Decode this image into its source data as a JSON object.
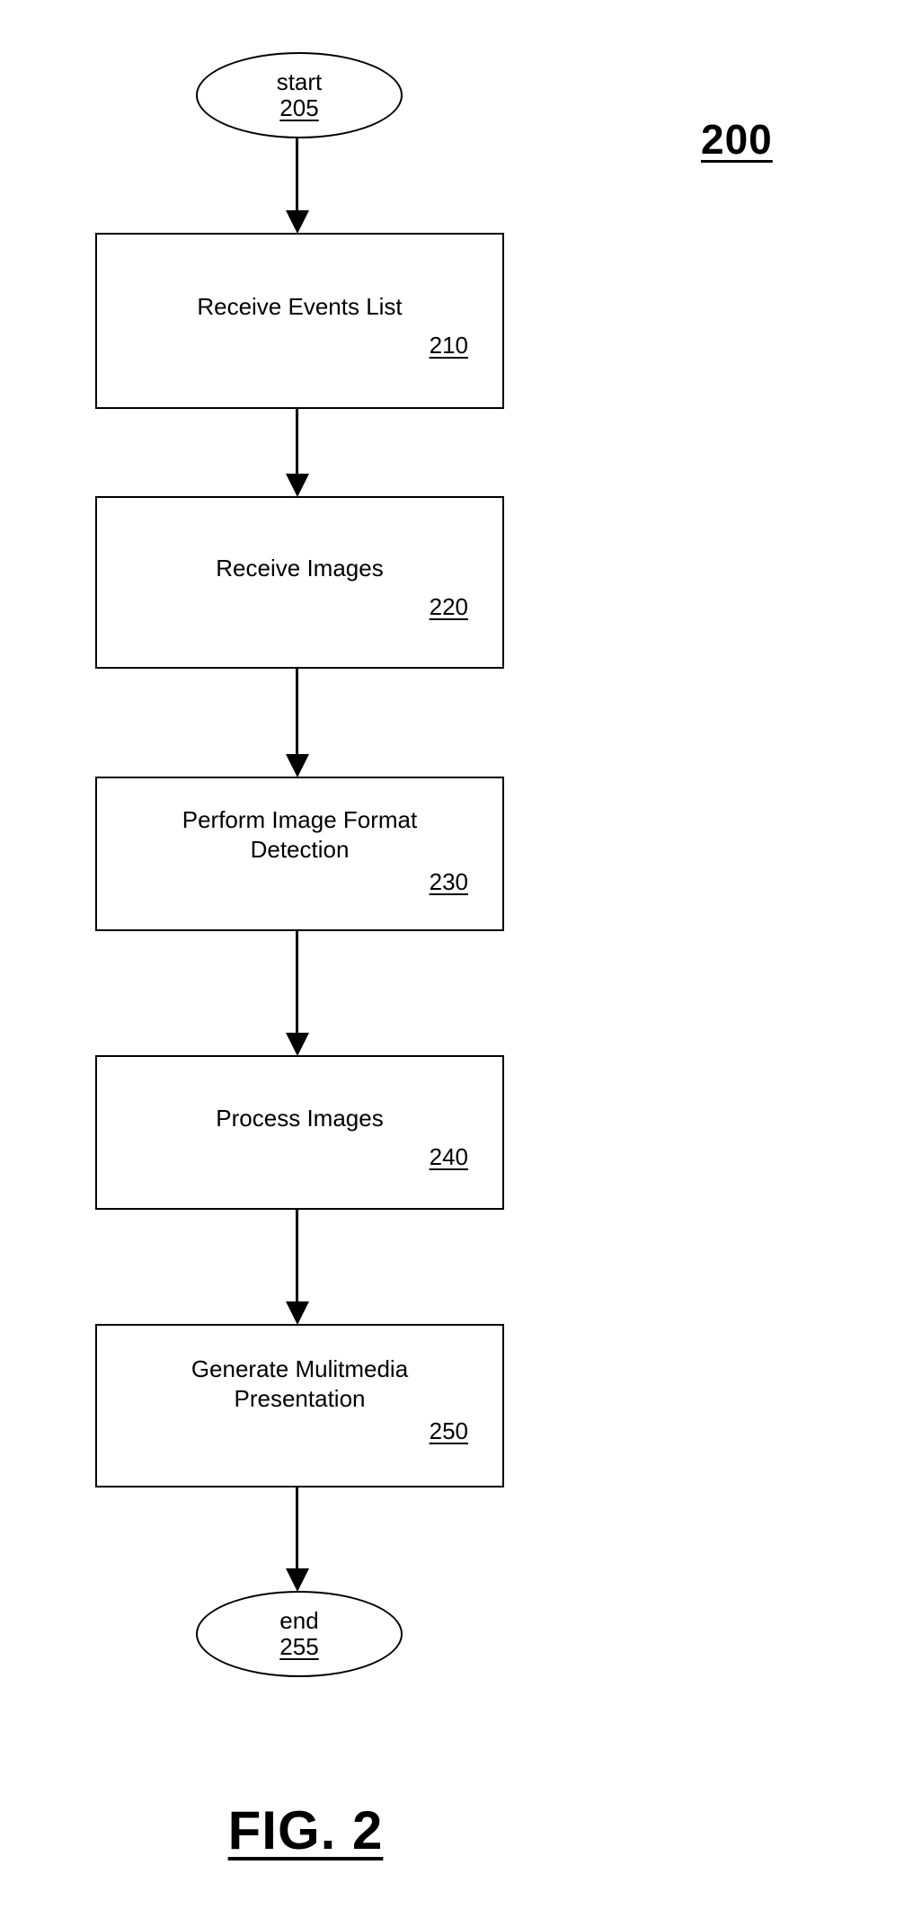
{
  "figure": {
    "reference_number": "200",
    "caption": "FIG. 2"
  },
  "flowchart": {
    "type": "flowchart",
    "orientation": "top-to-bottom",
    "nodes": [
      {
        "id": "205",
        "shape": "ellipse",
        "label": "start",
        "number": "205"
      },
      {
        "id": "210",
        "shape": "rectangle",
        "label": "Receive Events List",
        "number": "210"
      },
      {
        "id": "220",
        "shape": "rectangle",
        "label": "Receive Images",
        "number": "220"
      },
      {
        "id": "230",
        "shape": "rectangle",
        "label": "Perform Image Format\nDetection",
        "number": "230"
      },
      {
        "id": "240",
        "shape": "rectangle",
        "label": "Process Images",
        "number": "240"
      },
      {
        "id": "250",
        "shape": "rectangle",
        "label": "Generate Mulitmedia\nPresentation",
        "number": "250"
      },
      {
        "id": "255",
        "shape": "ellipse",
        "label": "end",
        "number": "255"
      }
    ],
    "edges": [
      {
        "from": "205",
        "to": "210",
        "style": "solid-arrow"
      },
      {
        "from": "210",
        "to": "220",
        "style": "solid-arrow"
      },
      {
        "from": "220",
        "to": "230",
        "style": "solid-arrow"
      },
      {
        "from": "230",
        "to": "240",
        "style": "solid-arrow"
      },
      {
        "from": "240",
        "to": "250",
        "style": "solid-arrow"
      },
      {
        "from": "250",
        "to": "255",
        "style": "solid-arrow"
      }
    ]
  },
  "colors": {
    "stroke": "#000000",
    "background": "#ffffff"
  }
}
